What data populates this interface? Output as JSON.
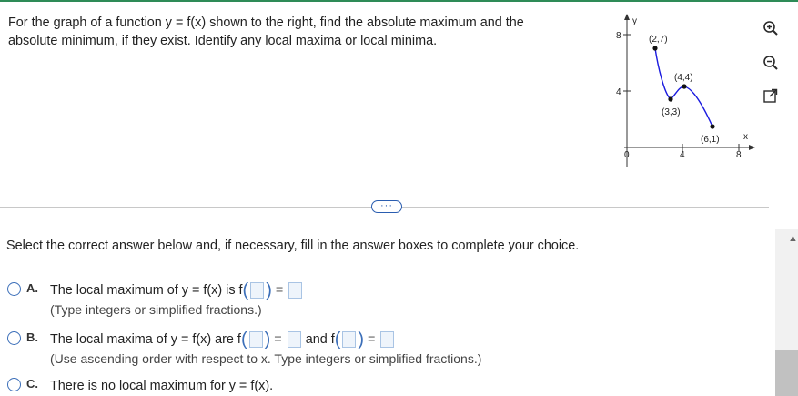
{
  "question": {
    "line1": "For the graph of a function y = f(x) shown to the right, find the absolute maximum and the",
    "line2": "absolute minimum, if they exist. Identify any local maxima or local minima."
  },
  "graph": {
    "axis_y_label": "y",
    "axis_x_label": "x",
    "y_ticks": [
      "8",
      "4"
    ],
    "x_ticks": [
      "0",
      "4",
      "8"
    ],
    "points": [
      {
        "label": "(2,7)",
        "x": 2,
        "y": 7
      },
      {
        "label": "(4,4)",
        "x": 4,
        "y": 4
      },
      {
        "label": "(3,3)",
        "x": 3,
        "y": 3
      },
      {
        "label": "(6,1)",
        "x": 6,
        "y": 1
      }
    ],
    "curve_color": "#1a1adf"
  },
  "toolbar": {
    "zoom_in": "zoom-in-icon",
    "zoom_out": "zoom-out-icon",
    "popout": "popout-icon"
  },
  "more_label": "···",
  "instruction": "Select the correct answer below and, if necessary, fill in the answer boxes to complete your choice.",
  "options": {
    "a": {
      "letter": "A.",
      "prefix": "The local maximum of y = f(x) is f",
      "eq": "=",
      "hint": "(Type integers or simplified fractions.)"
    },
    "b": {
      "letter": "B.",
      "prefix": "The local maxima of y = f(x) are f",
      "eq": "=",
      "and": "and f",
      "eq2": "=",
      "hint": "(Use ascending order with respect to x. Type integers or simplified fractions.)"
    },
    "c": {
      "letter": "C.",
      "text": "There is no local maximum for y = f(x)."
    }
  },
  "colors": {
    "accent": "#3c6fb9",
    "top_bar": "#2e8b57"
  }
}
